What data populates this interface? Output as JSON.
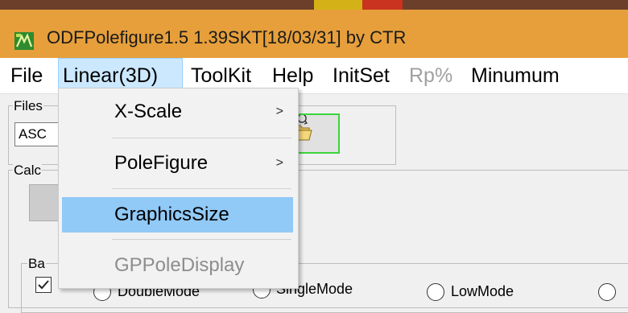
{
  "window": {
    "title": "ODFPolefigure1.5 1.39SKT[18/03/31] by CTR"
  },
  "menubar": {
    "items": [
      {
        "label": "File"
      },
      {
        "label": "Linear(3D)"
      },
      {
        "label": "ToolKit"
      },
      {
        "label": "Help"
      },
      {
        "label": "InitSet"
      },
      {
        "label": "Rp%"
      },
      {
        "label": "Minumum"
      }
    ]
  },
  "dropdown": {
    "items": [
      {
        "label": "X-Scale",
        "submenu_arrow": ">"
      },
      {
        "label": "PoleFigure",
        "submenu_arrow": ">"
      },
      {
        "label": "GraphicsSize"
      },
      {
        "label": "GPPoleDisplay"
      }
    ]
  },
  "main": {
    "files_group_label": "Files",
    "file_type_value": "ASC",
    "calc_group_label": "Calc",
    "bg_group_label": "Ba",
    "radio_options": [
      {
        "label": "DoubleMode"
      },
      {
        "label": "SingleMode"
      },
      {
        "label": "LowMode"
      }
    ]
  },
  "colors": {
    "titlebar": "#e69f3b",
    "menu_open_bg": "#cce8ff",
    "dropdown_highlight": "#91c9f7",
    "folder_button_border": "#3cd43c"
  }
}
